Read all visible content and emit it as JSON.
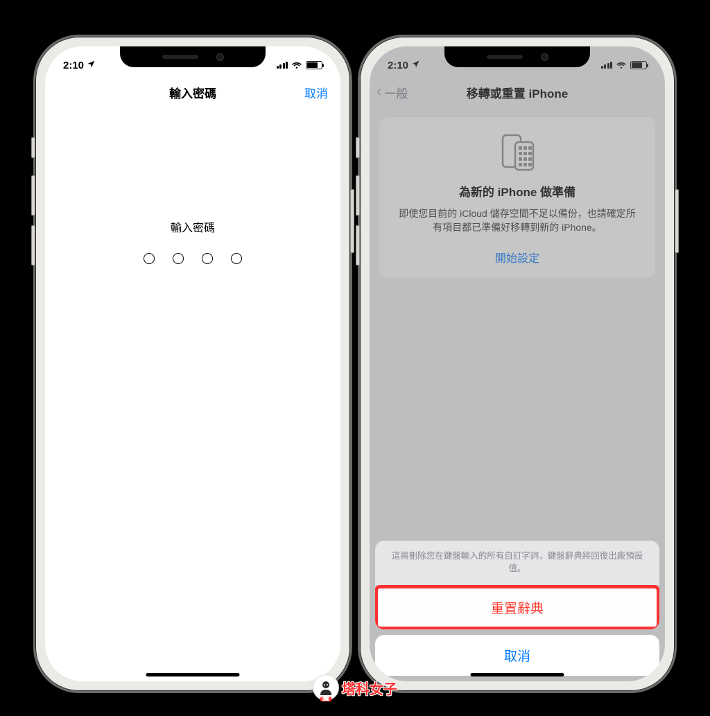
{
  "status": {
    "time": "2:10",
    "location_icon": "location-arrow"
  },
  "phone1": {
    "nav": {
      "title": "輸入密碼",
      "cancel": "取消"
    },
    "passcode": {
      "label": "輸入密碼"
    }
  },
  "phone2": {
    "nav": {
      "back": "一般",
      "title": "移轉或重置 iPhone"
    },
    "card": {
      "title": "為新的 iPhone 做準備",
      "desc": "即使您目前的 iCloud 儲存空間不足以備份，也請確定所有項目都已準備好移轉到新的 iPhone。",
      "link": "開始設定"
    },
    "sheet": {
      "message": "這將刪除您在鍵盤輸入的所有自訂字詞，鍵盤辭典將回復出廠預設值。",
      "destructive": "重置辭典",
      "cancel": "取消"
    }
  },
  "watermark": {
    "text": "塔科女子",
    "badge": "3C"
  }
}
